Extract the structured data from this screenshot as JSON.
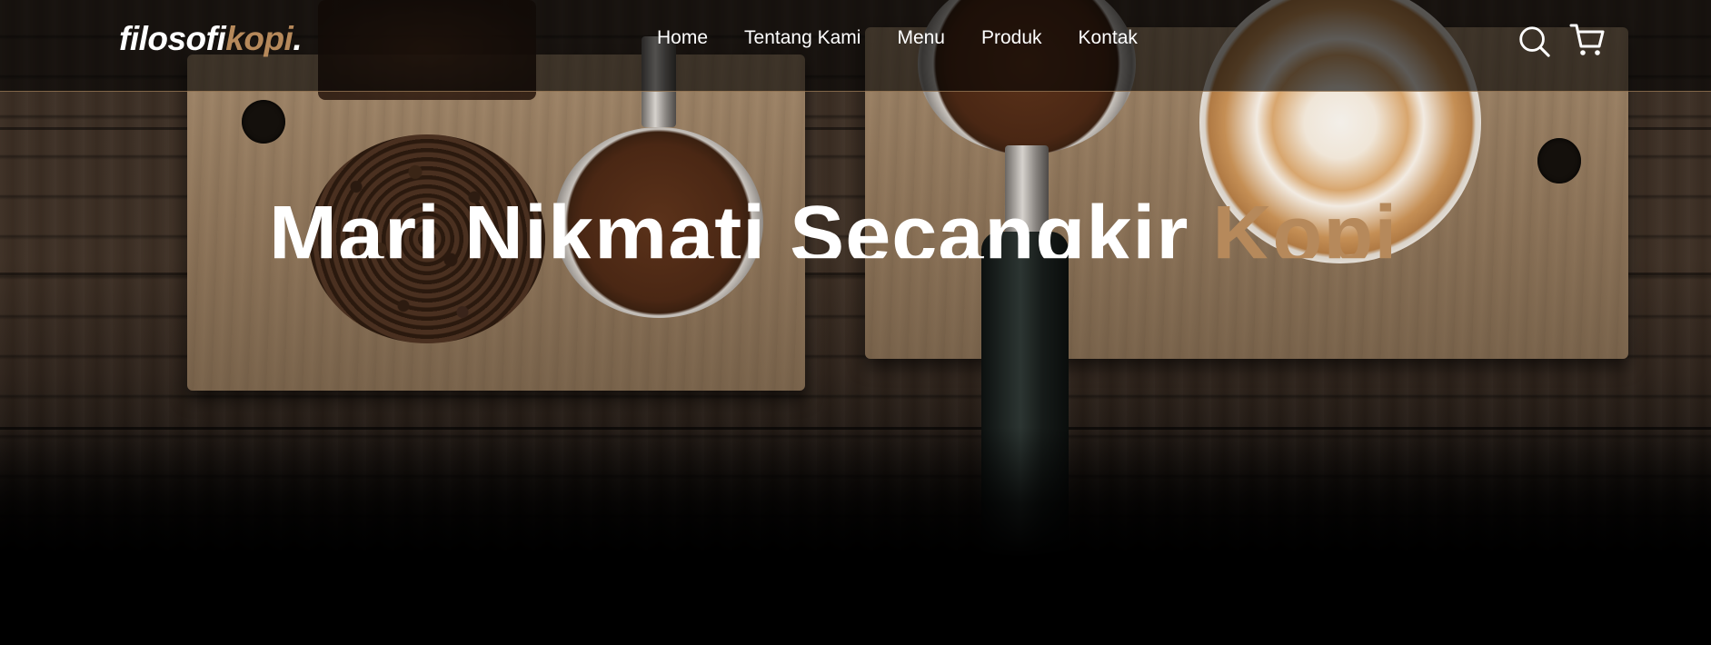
{
  "logo": {
    "main": "filosofi",
    "accent": "kopi",
    "suffix": "."
  },
  "nav": {
    "items": [
      {
        "label": "Home"
      },
      {
        "label": "Tentang Kami"
      },
      {
        "label": "Menu"
      },
      {
        "label": "Produk"
      },
      {
        "label": "Kontak"
      }
    ]
  },
  "actions": {
    "search_icon": "search-icon",
    "cart_icon": "shopping-cart-icon"
  },
  "hero": {
    "headline_main": "Mari Nikmati Secangkir ",
    "headline_accent": "Kopi"
  },
  "colors": {
    "accent": "#b6895b",
    "text": "#ffffff",
    "navbar_bg": "rgba(1,1,1,0.62)"
  }
}
